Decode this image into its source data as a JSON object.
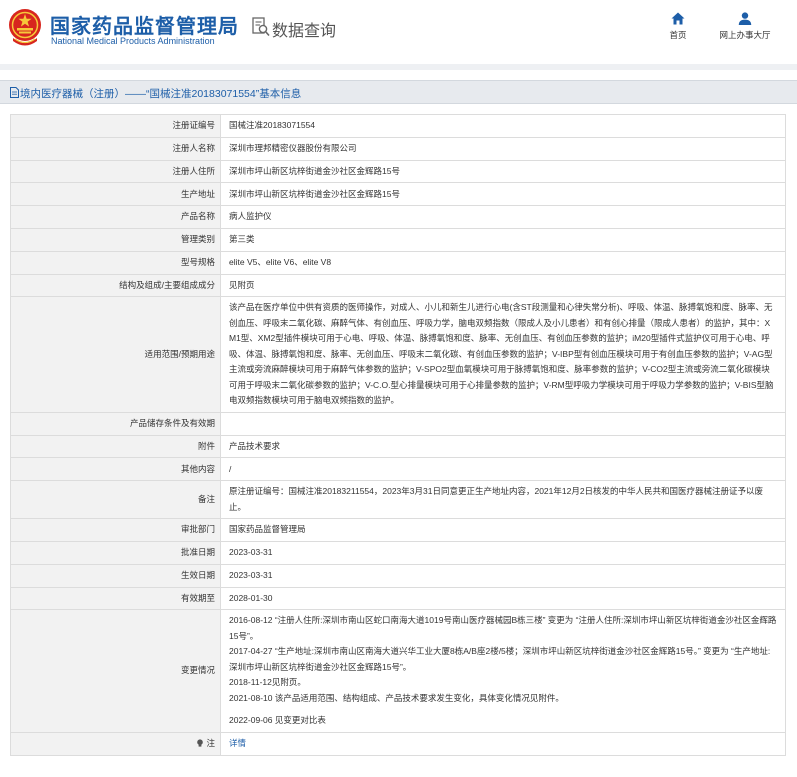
{
  "header": {
    "brand_cn": "国家药品监督管理局",
    "brand_en": "National Medical Products Administration",
    "section": "数据查询",
    "nav": [
      {
        "label": "首页",
        "icon": "home-icon"
      },
      {
        "label": "网上办事大厅",
        "icon": "user-icon"
      }
    ]
  },
  "page_title": "境内医疗器械（注册）——“国械注准20183071554”基本信息",
  "colors": {
    "brand_blue": "#1d5ea8",
    "label_bg": "#f2f2f2",
    "titlebar_bg": "#e7eaee"
  },
  "fields": [
    {
      "label": "注册证编号",
      "value": "国械注准20183071554"
    },
    {
      "label": "注册人名称",
      "value": "深圳市理邦精密仪器股份有限公司"
    },
    {
      "label": "注册人住所",
      "value": "深圳市坪山新区坑梓街道金沙社区金辉路15号"
    },
    {
      "label": "生产地址",
      "value": "深圳市坪山新区坑梓街道金沙社区金辉路15号"
    },
    {
      "label": "产品名称",
      "value": "病人监护仪"
    },
    {
      "label": "管理类别",
      "value": "第三类"
    },
    {
      "label": "型号规格",
      "value": "elite V5、elite V6、elite V8"
    },
    {
      "label": "结构及组成/主要组成成分",
      "value": "见附页"
    },
    {
      "label": "适用范围/预期用途",
      "value": "该产品在医疗单位中供有资质的医师操作，对成人、小儿和新生儿进行心电(含ST段测量和心律失常分析)、呼吸、体温、脉搏氧饱和度、脉率、无创血压、呼吸末二氧化碳、麻醉气体、有创血压、呼吸力学，脑电双频指数（限成人及小儿患者）和有创心排量（限成人患者）的监护，其中：XM1型、XM2型插件模块可用于心电、呼吸、体温、脉搏氧饱和度、脉率、无创血压、有创血压参数的监护；iM20型插件式监护仪可用于心电、呼吸、体温、脉搏氧饱和度、脉率、无创血压、呼吸末二氧化碳、有创血压参数的监护；V-IBP型有创血压模块可用于有创血压参数的监护；V-AG型主流或旁流麻醉模块可用于麻醉气体参数的监护；V-SPO2型血氧模块可用于脉搏氧饱和度、脉率参数的监护；V-CO2型主流或旁流二氧化碳模块可用于呼吸末二氧化碳参数的监护；V-C.O.型心排量模块可用于心排量参数的监护；V-RM型呼吸力学模块可用于呼吸力学参数的监护；V-BIS型脑电双频指数模块可用于脑电双频指数的监护。"
    },
    {
      "label": "产品储存条件及有效期",
      "value": ""
    },
    {
      "label": "附件",
      "value": "产品技术要求"
    },
    {
      "label": "其他内容",
      "value": "/"
    },
    {
      "label": "备注",
      "value": "原注册证编号：国械注准20183211554，2023年3月31日同意更正生产地址内容，2021年12月2日核发的中华人民共和国医疗器械注册证予以废止。"
    },
    {
      "label": "审批部门",
      "value": "国家药品监督管理局"
    },
    {
      "label": "批准日期",
      "value": "2023-03-31"
    },
    {
      "label": "生效日期",
      "value": "2023-03-31"
    },
    {
      "label": "有效期至",
      "value": "2028-01-30"
    }
  ],
  "changes": {
    "label": "变更情况",
    "lines": [
      "2016-08-12 “注册人住所:深圳市南山区蛇口南海大道1019号南山医疗器械园B栋三楼” 变更为 “注册人住所:深圳市坪山新区坑梓街道金沙社区金辉路15号”。",
      "2017-04-27 “生产地址:深圳市南山区南海大道兴华工业大厦8栋A/B座2楼/5楼；深圳市坪山新区坑梓街道金沙社区金辉路15号。” 变更为 “生产地址:深圳市坪山新区坑梓街道金沙社区金辉路15号”。",
      "2018-11-12见附页。",
      "2021-08-10 该产品适用范围、结构组成、产品技术要求发生变化，具体变化情况见附件。",
      "2022-09-06 见变更对比表"
    ]
  },
  "notes": {
    "label": "注",
    "value": "详情"
  }
}
